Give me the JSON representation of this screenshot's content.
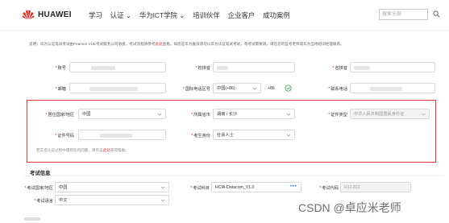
{
  "header": {
    "brand": "HUAWEI",
    "nav": [
      "学习",
      "认证",
      "华为ICT学院",
      "培训伙伴",
      "企业客户",
      "成功案例"
    ],
    "search_placeholder": "搜索全部"
  },
  "notice": {
    "text": "说明：华为认证笔试考试由Pearson VUE考试服务公司承接，考试流程请参考",
    "link": "此处",
    "tail": "查看。如您是华为雇员请勿以华为认证笔试考试，有考试需要请，请在您的监考老师或华为当地培训经理联系。"
  },
  "personal": {
    "account_label": "账号",
    "surname_label": "姓拼音",
    "givenname_label": "名拼音",
    "email_label": "邮箱",
    "intl_phone_label": "国际电话区号",
    "intl_phone_value": "中国(+86)",
    "phone_prefix": "+86",
    "contact_phone_label": "联系电话"
  },
  "residence": {
    "country_label": "居住国家/地区",
    "country_value": "中国",
    "city_label": "所属省市",
    "city_value": "湖南 / 长沙",
    "id_type_label": "证件类型",
    "id_type_value": "中华人民共和国居民身份证",
    "id_number_label": "证件号码",
    "identity_label": "考生身份",
    "identity_value": "社会人士",
    "hint_text": "若实名认证过程中遇到任何问题，请点击",
    "hint_link": "此处",
    "hint_tail": "获得帮助。"
  },
  "exam": {
    "section_title": "考试信息",
    "country_label": "考试国家/地区",
    "country_value": "中国",
    "subject_label": "考试科目",
    "subject_value": "HCIA-Datacom_V1.0",
    "code_label": "考试代码",
    "code_value": "H12-811",
    "language_label": "考试语言",
    "language_value": "中文"
  },
  "watermark": "CSDN @卓应米老师"
}
